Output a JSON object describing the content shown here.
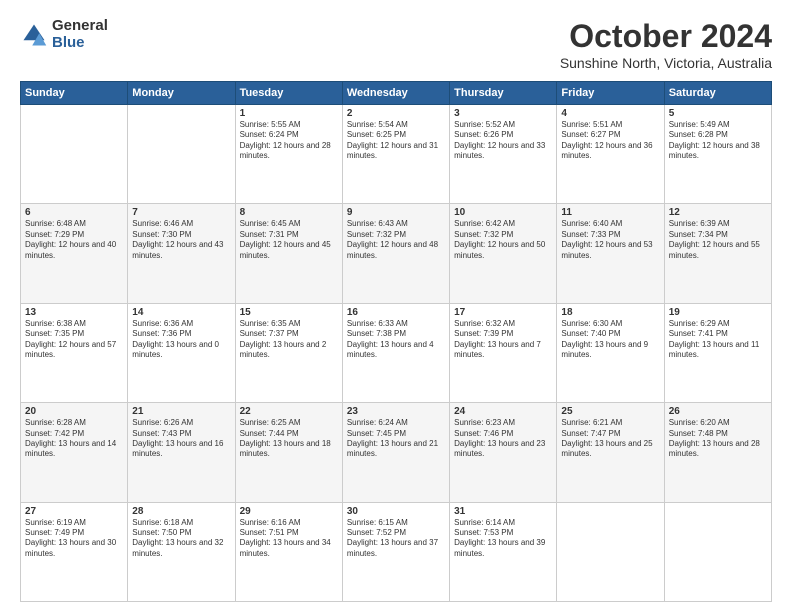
{
  "header": {
    "logo_general": "General",
    "logo_blue": "Blue",
    "month_title": "October 2024",
    "location": "Sunshine North, Victoria, Australia"
  },
  "days_of_week": [
    "Sunday",
    "Monday",
    "Tuesday",
    "Wednesday",
    "Thursday",
    "Friday",
    "Saturday"
  ],
  "weeks": [
    [
      {
        "day": "",
        "sunrise": "",
        "sunset": "",
        "daylight": ""
      },
      {
        "day": "",
        "sunrise": "",
        "sunset": "",
        "daylight": ""
      },
      {
        "day": "1",
        "sunrise": "Sunrise: 5:55 AM",
        "sunset": "Sunset: 6:24 PM",
        "daylight": "Daylight: 12 hours and 28 minutes."
      },
      {
        "day": "2",
        "sunrise": "Sunrise: 5:54 AM",
        "sunset": "Sunset: 6:25 PM",
        "daylight": "Daylight: 12 hours and 31 minutes."
      },
      {
        "day": "3",
        "sunrise": "Sunrise: 5:52 AM",
        "sunset": "Sunset: 6:26 PM",
        "daylight": "Daylight: 12 hours and 33 minutes."
      },
      {
        "day": "4",
        "sunrise": "Sunrise: 5:51 AM",
        "sunset": "Sunset: 6:27 PM",
        "daylight": "Daylight: 12 hours and 36 minutes."
      },
      {
        "day": "5",
        "sunrise": "Sunrise: 5:49 AM",
        "sunset": "Sunset: 6:28 PM",
        "daylight": "Daylight: 12 hours and 38 minutes."
      }
    ],
    [
      {
        "day": "6",
        "sunrise": "Sunrise: 6:48 AM",
        "sunset": "Sunset: 7:29 PM",
        "daylight": "Daylight: 12 hours and 40 minutes."
      },
      {
        "day": "7",
        "sunrise": "Sunrise: 6:46 AM",
        "sunset": "Sunset: 7:30 PM",
        "daylight": "Daylight: 12 hours and 43 minutes."
      },
      {
        "day": "8",
        "sunrise": "Sunrise: 6:45 AM",
        "sunset": "Sunset: 7:31 PM",
        "daylight": "Daylight: 12 hours and 45 minutes."
      },
      {
        "day": "9",
        "sunrise": "Sunrise: 6:43 AM",
        "sunset": "Sunset: 7:32 PM",
        "daylight": "Daylight: 12 hours and 48 minutes."
      },
      {
        "day": "10",
        "sunrise": "Sunrise: 6:42 AM",
        "sunset": "Sunset: 7:32 PM",
        "daylight": "Daylight: 12 hours and 50 minutes."
      },
      {
        "day": "11",
        "sunrise": "Sunrise: 6:40 AM",
        "sunset": "Sunset: 7:33 PM",
        "daylight": "Daylight: 12 hours and 53 minutes."
      },
      {
        "day": "12",
        "sunrise": "Sunrise: 6:39 AM",
        "sunset": "Sunset: 7:34 PM",
        "daylight": "Daylight: 12 hours and 55 minutes."
      }
    ],
    [
      {
        "day": "13",
        "sunrise": "Sunrise: 6:38 AM",
        "sunset": "Sunset: 7:35 PM",
        "daylight": "Daylight: 12 hours and 57 minutes."
      },
      {
        "day": "14",
        "sunrise": "Sunrise: 6:36 AM",
        "sunset": "Sunset: 7:36 PM",
        "daylight": "Daylight: 13 hours and 0 minutes."
      },
      {
        "day": "15",
        "sunrise": "Sunrise: 6:35 AM",
        "sunset": "Sunset: 7:37 PM",
        "daylight": "Daylight: 13 hours and 2 minutes."
      },
      {
        "day": "16",
        "sunrise": "Sunrise: 6:33 AM",
        "sunset": "Sunset: 7:38 PM",
        "daylight": "Daylight: 13 hours and 4 minutes."
      },
      {
        "day": "17",
        "sunrise": "Sunrise: 6:32 AM",
        "sunset": "Sunset: 7:39 PM",
        "daylight": "Daylight: 13 hours and 7 minutes."
      },
      {
        "day": "18",
        "sunrise": "Sunrise: 6:30 AM",
        "sunset": "Sunset: 7:40 PM",
        "daylight": "Daylight: 13 hours and 9 minutes."
      },
      {
        "day": "19",
        "sunrise": "Sunrise: 6:29 AM",
        "sunset": "Sunset: 7:41 PM",
        "daylight": "Daylight: 13 hours and 11 minutes."
      }
    ],
    [
      {
        "day": "20",
        "sunrise": "Sunrise: 6:28 AM",
        "sunset": "Sunset: 7:42 PM",
        "daylight": "Daylight: 13 hours and 14 minutes."
      },
      {
        "day": "21",
        "sunrise": "Sunrise: 6:26 AM",
        "sunset": "Sunset: 7:43 PM",
        "daylight": "Daylight: 13 hours and 16 minutes."
      },
      {
        "day": "22",
        "sunrise": "Sunrise: 6:25 AM",
        "sunset": "Sunset: 7:44 PM",
        "daylight": "Daylight: 13 hours and 18 minutes."
      },
      {
        "day": "23",
        "sunrise": "Sunrise: 6:24 AM",
        "sunset": "Sunset: 7:45 PM",
        "daylight": "Daylight: 13 hours and 21 minutes."
      },
      {
        "day": "24",
        "sunrise": "Sunrise: 6:23 AM",
        "sunset": "Sunset: 7:46 PM",
        "daylight": "Daylight: 13 hours and 23 minutes."
      },
      {
        "day": "25",
        "sunrise": "Sunrise: 6:21 AM",
        "sunset": "Sunset: 7:47 PM",
        "daylight": "Daylight: 13 hours and 25 minutes."
      },
      {
        "day": "26",
        "sunrise": "Sunrise: 6:20 AM",
        "sunset": "Sunset: 7:48 PM",
        "daylight": "Daylight: 13 hours and 28 minutes."
      }
    ],
    [
      {
        "day": "27",
        "sunrise": "Sunrise: 6:19 AM",
        "sunset": "Sunset: 7:49 PM",
        "daylight": "Daylight: 13 hours and 30 minutes."
      },
      {
        "day": "28",
        "sunrise": "Sunrise: 6:18 AM",
        "sunset": "Sunset: 7:50 PM",
        "daylight": "Daylight: 13 hours and 32 minutes."
      },
      {
        "day": "29",
        "sunrise": "Sunrise: 6:16 AM",
        "sunset": "Sunset: 7:51 PM",
        "daylight": "Daylight: 13 hours and 34 minutes."
      },
      {
        "day": "30",
        "sunrise": "Sunrise: 6:15 AM",
        "sunset": "Sunset: 7:52 PM",
        "daylight": "Daylight: 13 hours and 37 minutes."
      },
      {
        "day": "31",
        "sunrise": "Sunrise: 6:14 AM",
        "sunset": "Sunset: 7:53 PM",
        "daylight": "Daylight: 13 hours and 39 minutes."
      },
      {
        "day": "",
        "sunrise": "",
        "sunset": "",
        "daylight": ""
      },
      {
        "day": "",
        "sunrise": "",
        "sunset": "",
        "daylight": ""
      }
    ]
  ]
}
